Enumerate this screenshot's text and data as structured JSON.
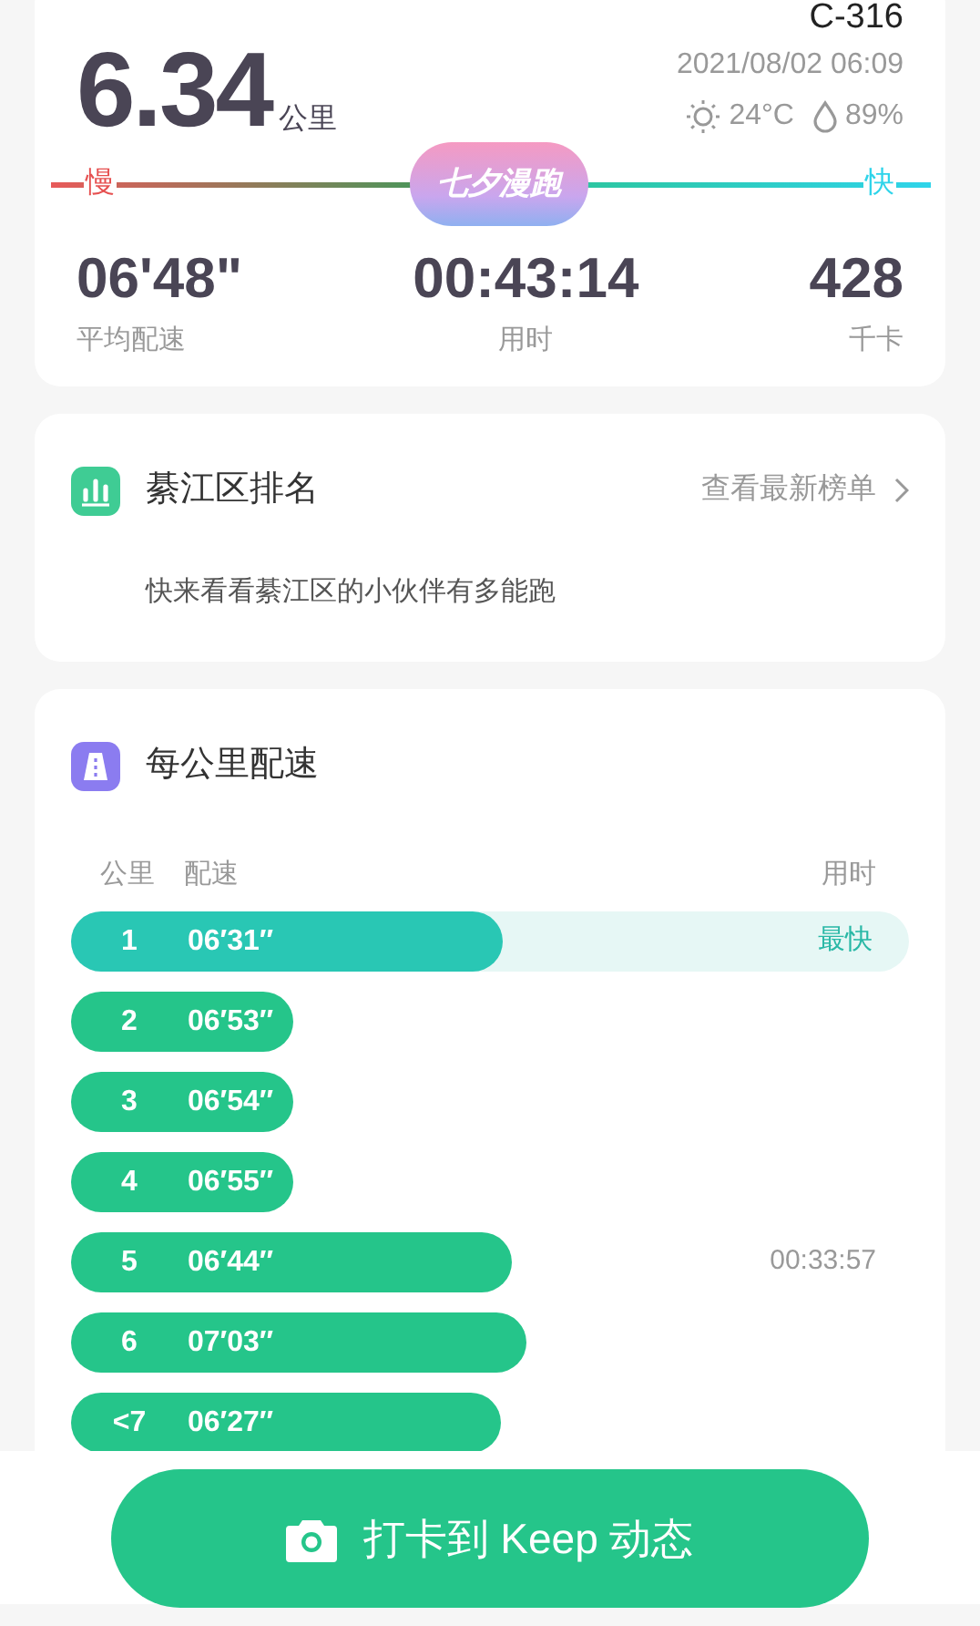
{
  "summary": {
    "code": "C-316",
    "distance": "6.34",
    "distance_unit": "公里",
    "datetime": "2021/08/02 06:09",
    "temperature": "24°C",
    "humidity": "89%",
    "slow_label": "慢",
    "fast_label": "快",
    "badge": "七夕漫跑",
    "stats": [
      {
        "value": "06'48\"",
        "label": "平均配速"
      },
      {
        "value": "00:43:14",
        "label": "用时"
      },
      {
        "value": "428",
        "label": "千卡"
      }
    ]
  },
  "ranking": {
    "title": "綦江区排名",
    "link": "查看最新榜单",
    "description": "快来看看綦江区的小伙伴有多能跑"
  },
  "pace": {
    "title": "每公里配速",
    "columns": [
      "公里",
      "配速",
      "用时"
    ],
    "rows": [
      {
        "km": "1",
        "pace": "06′31″",
        "level": 0.516,
        "fastest": true,
        "note": "最快"
      },
      {
        "km": "2",
        "pace": "06′53″",
        "fastest": false
      },
      {
        "km": "3",
        "pace": "06′54″",
        "fastest": false
      },
      {
        "km": "4",
        "pace": "06′55″",
        "fastest": false
      },
      {
        "km": "5",
        "pace": "06′44″",
        "fastest": false,
        "note": "00:33:57"
      },
      {
        "km": "6",
        "pace": "07′03″",
        "fastest": false
      },
      {
        "km": "<7",
        "pace": "06′27″",
        "fastest": false
      }
    ]
  },
  "action_button": "打卡到 Keep 动态"
}
